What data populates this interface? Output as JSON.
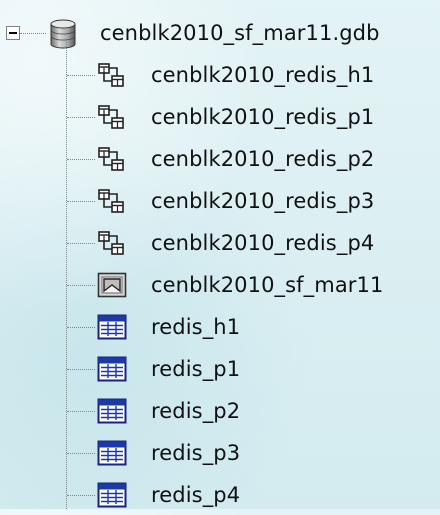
{
  "tree": {
    "root": {
      "label": "cenblk2010_sf_mar11.gdb",
      "icon": "file-geodatabase-icon",
      "expanded": true
    },
    "children": [
      {
        "label": "cenblk2010_redis_h1",
        "icon": "relationship-class-icon"
      },
      {
        "label": "cenblk2010_redis_p1",
        "icon": "relationship-class-icon"
      },
      {
        "label": "cenblk2010_redis_p2",
        "icon": "relationship-class-icon"
      },
      {
        "label": "cenblk2010_redis_p3",
        "icon": "relationship-class-icon"
      },
      {
        "label": "cenblk2010_redis_p4",
        "icon": "relationship-class-icon"
      },
      {
        "label": "cenblk2010_sf_mar11",
        "icon": "polygon-feature-class-icon"
      },
      {
        "label": "redis_h1",
        "icon": "table-icon"
      },
      {
        "label": "redis_p1",
        "icon": "table-icon"
      },
      {
        "label": "redis_p2",
        "icon": "table-icon"
      },
      {
        "label": "redis_p3",
        "icon": "table-icon"
      },
      {
        "label": "redis_p4",
        "icon": "table-icon"
      }
    ]
  }
}
